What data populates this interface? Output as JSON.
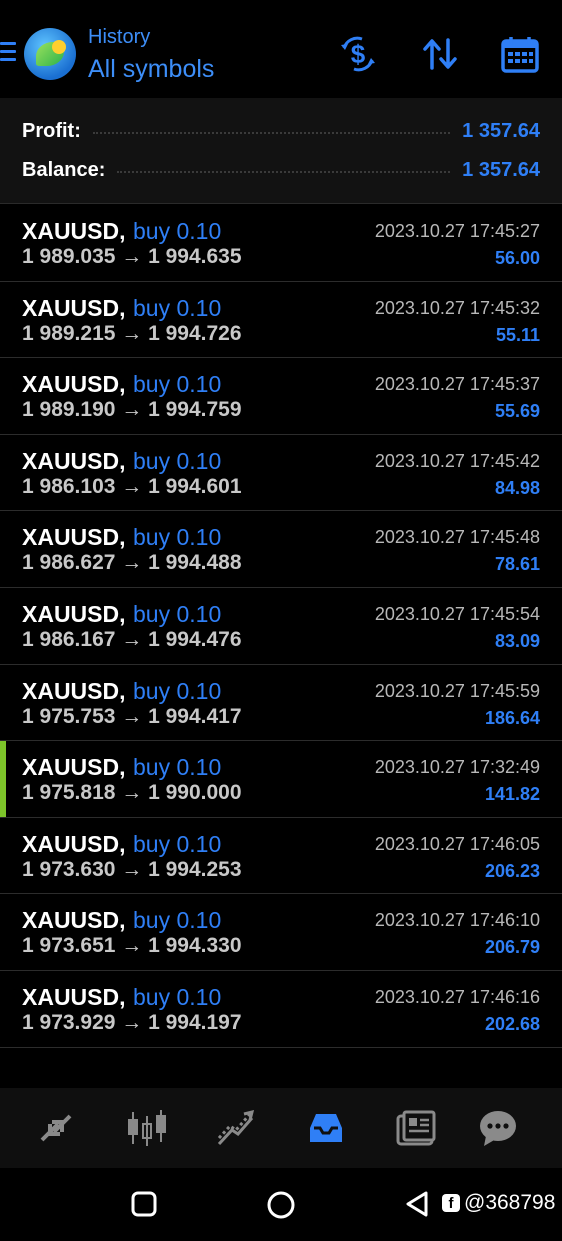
{
  "header": {
    "subtitle": "History",
    "title": "All symbols",
    "accent_color": "#2f7ff6",
    "icons": [
      "menu-icon",
      "metatrader-logo",
      "currency-exchange-icon",
      "sort-icon",
      "calendar-icon"
    ]
  },
  "summary": {
    "profit_label": "Profit:",
    "profit_value": "1 357.64",
    "balance_label": "Balance:",
    "balance_value": "1 357.64"
  },
  "deals": [
    {
      "symbol": "XAUUSD,",
      "type": "buy 0.10",
      "time": "2023.10.27 17:45:27",
      "prices": "1 989.035 → 1 994.635",
      "profit": "56.00"
    },
    {
      "symbol": "XAUUSD,",
      "type": "buy 0.10",
      "time": "2023.10.27 17:45:32",
      "prices": "1 989.215 → 1 994.726",
      "profit": "55.11"
    },
    {
      "symbol": "XAUUSD,",
      "type": "buy 0.10",
      "time": "2023.10.27 17:45:37",
      "prices": "1 989.190 → 1 994.759",
      "profit": "55.69"
    },
    {
      "symbol": "XAUUSD,",
      "type": "buy 0.10",
      "time": "2023.10.27 17:45:42",
      "prices": "1 986.103 → 1 994.601",
      "profit": "84.98"
    },
    {
      "symbol": "XAUUSD,",
      "type": "buy 0.10",
      "time": "2023.10.27 17:45:48",
      "prices": "1 986.627 → 1 994.488",
      "profit": "78.61"
    },
    {
      "symbol": "XAUUSD,",
      "type": "buy 0.10",
      "time": "2023.10.27 17:45:54",
      "prices": "1 986.167 → 1 994.476",
      "profit": "83.09"
    },
    {
      "symbol": "XAUUSD,",
      "type": "buy 0.10",
      "time": "2023.10.27 17:45:59",
      "prices": "1 975.753 → 1 994.417",
      "profit": "186.64"
    },
    {
      "symbol": "XAUUSD,",
      "type": "buy 0.10",
      "time": "2023.10.27 17:32:49",
      "prices": "1 975.818 → 1 990.000",
      "profit": "141.82",
      "active": true
    },
    {
      "symbol": "XAUUSD,",
      "type": "buy 0.10",
      "time": "2023.10.27 17:46:05",
      "prices": "1 973.630 → 1 994.253",
      "profit": "206.23"
    },
    {
      "symbol": "XAUUSD,",
      "type": "buy 0.10",
      "time": "2023.10.27 17:46:10",
      "prices": "1 973.651 → 1 994.330",
      "profit": "206.79"
    },
    {
      "symbol": "XAUUSD,",
      "type": "buy 0.10",
      "time": "2023.10.27 17:46:16",
      "prices": "1 973.929 → 1 994.197",
      "profit": "202.68"
    }
  ],
  "bottom_nav": {
    "items": [
      "quotes-icon",
      "chart-icon",
      "trade-icon",
      "history-icon",
      "news-icon",
      "chat-icon"
    ],
    "active": "history-icon"
  },
  "watermark": {
    "text": "@368798"
  }
}
